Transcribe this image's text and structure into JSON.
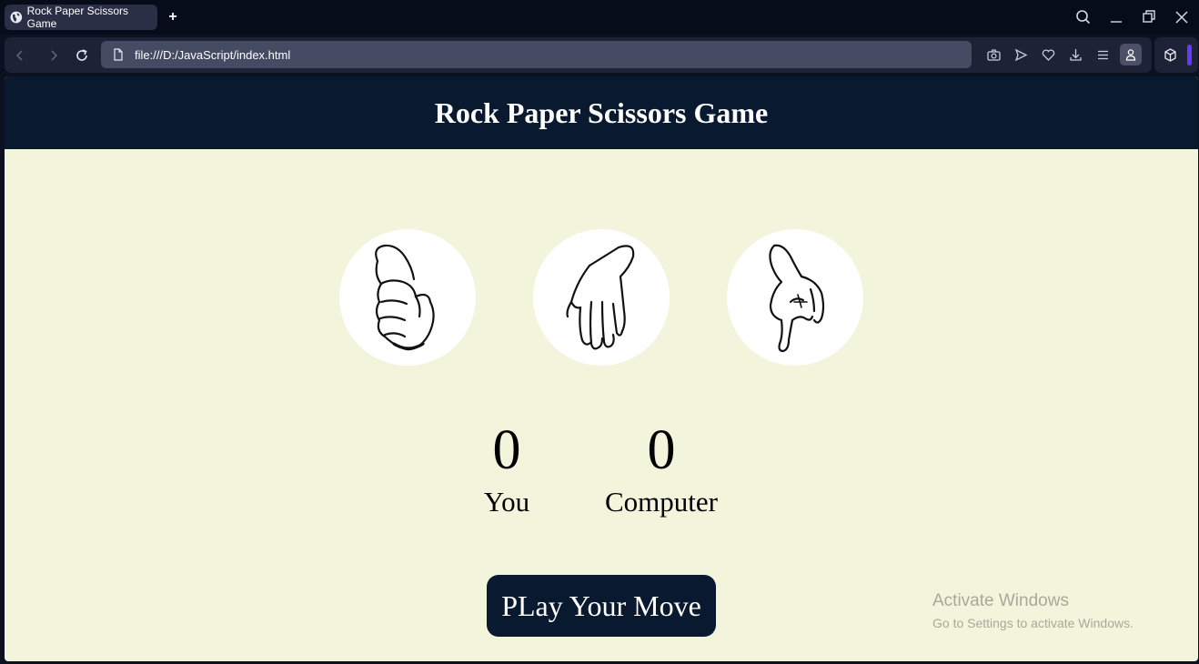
{
  "browser": {
    "tab_title": "Rock Paper Scissors Game",
    "new_tab_label": "+",
    "url": "file:///D:/JavaScript/index.html"
  },
  "page": {
    "header_title": "Rock Paper Scissors Game",
    "choices": [
      {
        "name": "rock",
        "icon": "fist-hand-icon"
      },
      {
        "name": "paper",
        "icon": "open-hand-icon"
      },
      {
        "name": "scissors",
        "icon": "scissors-hand-icon"
      }
    ],
    "scores": {
      "user_score": "0",
      "user_label": "You",
      "computer_score": "0",
      "computer_label": "Computer"
    },
    "message": "PLay Your Move"
  },
  "watermark": {
    "title": "Activate Windows",
    "subtitle": "Go to Settings to activate Windows."
  },
  "colors": {
    "header_bg": "#091a30",
    "page_bg": "#f3f4dc",
    "button_bg": "#091a30",
    "accent": "#6a37ff"
  }
}
